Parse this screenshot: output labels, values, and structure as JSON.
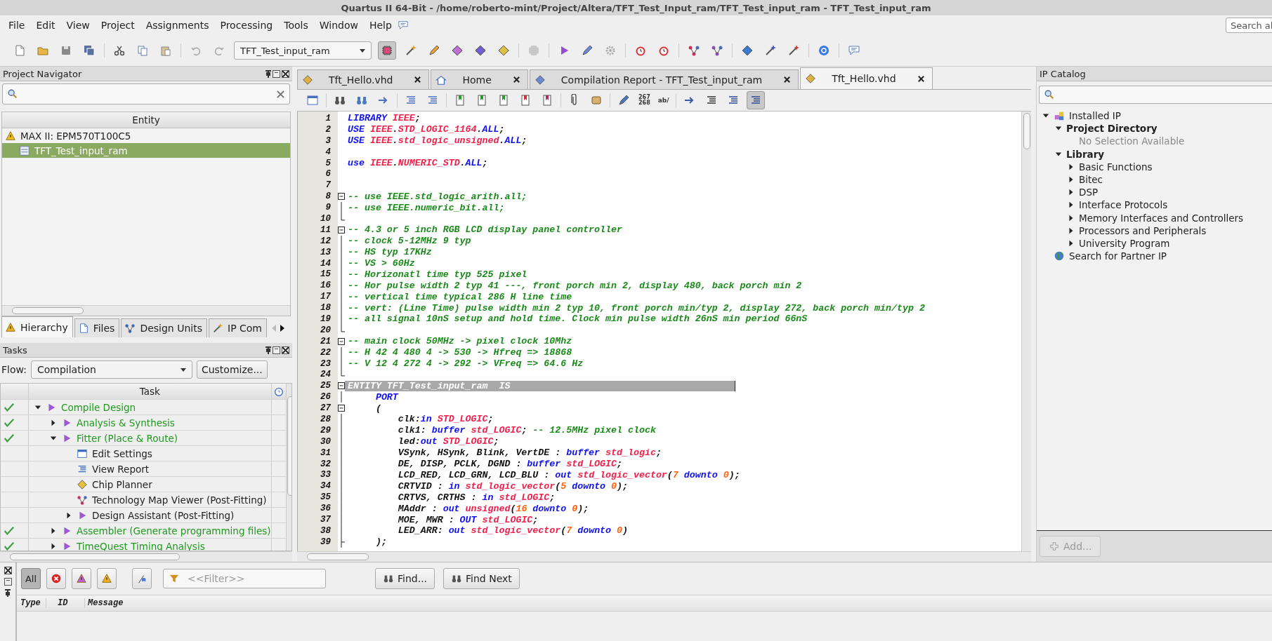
{
  "window": {
    "title": "Quartus II 64-Bit - /home/roberto-mint/Project/Altera/TFT_Test_Input_ram/TFT_Test_input_ram - TFT_Test_input_ram"
  },
  "menu": [
    "File",
    "Edit",
    "View",
    "Project",
    "Assignments",
    "Processing",
    "Tools",
    "Window",
    "Help"
  ],
  "search": {
    "placeholder": "Search al"
  },
  "toolbar": {
    "revision": "TFT_Test_input_ram"
  },
  "project_navigator": {
    "title": "Project Navigator",
    "column": "Entity",
    "rows": [
      {
        "label": "MAX II: EPM570T100C5",
        "kind": "device",
        "selected": false,
        "children": [
          {
            "label": "TFT_Test_input_ram",
            "kind": "entity",
            "selected": true
          }
        ]
      }
    ],
    "tabs": [
      {
        "label": "Hierarchy",
        "kind": "hierarchy",
        "selected": true
      },
      {
        "label": "Files",
        "kind": "files",
        "selected": false
      },
      {
        "label": "Design Units",
        "kind": "units",
        "selected": false
      },
      {
        "label": "IP Com",
        "kind": "ip",
        "selected": false
      }
    ]
  },
  "tasks": {
    "title": "Tasks",
    "flow_label": "Flow:",
    "flow": "Compilation",
    "customize": "Customize...",
    "column": "Task",
    "items": [
      {
        "label": "Compile Design",
        "kind": "flow",
        "done": true,
        "expanded": true,
        "children": [
          {
            "label": "Analysis & Synthesis",
            "kind": "flow",
            "done": true,
            "expanded": false
          },
          {
            "label": "Fitter (Place & Route)",
            "kind": "flow",
            "done": true,
            "expanded": true,
            "children": [
              {
                "label": "Edit Settings",
                "kind": "settings",
                "done": false
              },
              {
                "label": "View Report",
                "kind": "report",
                "done": false
              },
              {
                "label": "Chip Planner",
                "kind": "planner",
                "done": false
              },
              {
                "label": "Technology Map Viewer (Post-Fitting)",
                "kind": "viewer",
                "done": false
              },
              {
                "label": "Design Assistant (Post-Fitting)",
                "kind": "flow",
                "done": false,
                "expanded": false
              }
            ]
          },
          {
            "label": "Assembler (Generate programming files)",
            "kind": "flow",
            "done": true,
            "expanded": false
          },
          {
            "label": "TimeQuest Timing Analysis",
            "kind": "flow",
            "done": true,
            "expanded": false
          }
        ]
      }
    ]
  },
  "editor": {
    "tabs": [
      {
        "label": "Tft_Hello.vhd",
        "kind": "file",
        "selected": false
      },
      {
        "label": "Home",
        "kind": "home",
        "selected": false
      },
      {
        "label": "Compilation Report - TFT_Test_input_ram",
        "kind": "report",
        "selected": false
      },
      {
        "label": "Tft_Hello.vhd",
        "kind": "file",
        "selected": true
      }
    ],
    "toolbar_labels": {
      "goto_line": [
        "267",
        "268"
      ],
      "comment": "ab/"
    },
    "lines": [
      {
        "n": "1",
        "kind": "plain",
        "tokens": [
          {
            "kind": "keyword",
            "text": "LIBRARY"
          },
          {
            "kind": "type",
            "text": " IEEE"
          },
          {
            "kind": "plain",
            "text": ";"
          }
        ]
      },
      {
        "n": "2",
        "kind": "plain",
        "tokens": [
          {
            "kind": "keyword",
            "text": "USE"
          },
          {
            "kind": "type",
            "text": " IEEE"
          },
          {
            "kind": "plain",
            "text": "."
          },
          {
            "kind": "type",
            "text": "STD_LOGIC_1164"
          },
          {
            "kind": "plain",
            "text": "."
          },
          {
            "kind": "keyword",
            "text": "ALL"
          },
          {
            "kind": "plain",
            "text": ";"
          }
        ]
      },
      {
        "n": "3",
        "kind": "plain",
        "tokens": [
          {
            "kind": "keyword",
            "text": "USE"
          },
          {
            "kind": "type",
            "text": " IEEE"
          },
          {
            "kind": "plain",
            "text": "."
          },
          {
            "kind": "type",
            "text": "std_logic_unsigned"
          },
          {
            "kind": "plain",
            "text": "."
          },
          {
            "kind": "keyword",
            "text": "ALL"
          },
          {
            "kind": "plain",
            "text": ";"
          }
        ]
      },
      {
        "n": "4",
        "kind": "plain"
      },
      {
        "n": "5",
        "kind": "plain",
        "tokens": [
          {
            "kind": "keyword",
            "text": "use"
          },
          {
            "kind": "type",
            "text": " IEEE"
          },
          {
            "kind": "plain",
            "text": "."
          },
          {
            "kind": "type",
            "text": "NUMERIC_STD"
          },
          {
            "kind": "plain",
            "text": "."
          },
          {
            "kind": "keyword",
            "text": "ALL"
          },
          {
            "kind": "plain",
            "text": ";"
          }
        ]
      },
      {
        "n": "6",
        "kind": "plain"
      },
      {
        "n": "7",
        "kind": "plain"
      },
      {
        "n": "8",
        "kind": "fold_start",
        "tokens": [
          {
            "kind": "comment",
            "text": "-- use IEEE.std_logic_arith.all;"
          }
        ]
      },
      {
        "n": "9",
        "kind": "fold_body",
        "tokens": [
          {
            "kind": "comment",
            "text": "-- use IEEE.numeric_bit.all;"
          }
        ]
      },
      {
        "n": "10",
        "kind": "fold_end"
      },
      {
        "n": "11",
        "kind": "fold_start",
        "tokens": [
          {
            "kind": "comment",
            "text": "-- 4.3 or 5 inch RGB LCD display panel controller"
          }
        ]
      },
      {
        "n": "12",
        "kind": "fold_body",
        "tokens": [
          {
            "kind": "comment",
            "text": "-- clock 5-12MHz 9 typ"
          }
        ]
      },
      {
        "n": "13",
        "kind": "fold_body",
        "tokens": [
          {
            "kind": "comment",
            "text": "-- HS typ 17KHz"
          }
        ]
      },
      {
        "n": "14",
        "kind": "fold_body",
        "tokens": [
          {
            "kind": "comment",
            "text": "-- VS > 60Hz"
          }
        ]
      },
      {
        "n": "15",
        "kind": "fold_body",
        "tokens": [
          {
            "kind": "comment",
            "text": "-- Horizonatl time typ 525 pixel"
          }
        ]
      },
      {
        "n": "16",
        "kind": "fold_body",
        "tokens": [
          {
            "kind": "comment",
            "text": "-- Hor pulse width 2 typ 41 ---, front porch min 2, display 480, back porch min 2"
          }
        ]
      },
      {
        "n": "17",
        "kind": "fold_body",
        "tokens": [
          {
            "kind": "comment",
            "text": "-- vertical time typical 286 H line time"
          }
        ]
      },
      {
        "n": "18",
        "kind": "fold_body",
        "tokens": [
          {
            "kind": "comment",
            "text": "-- vert: (Line Time) pulse width min 2 typ 10, front porch min/typ 2, display 272, back porch min/typ 2"
          }
        ]
      },
      {
        "n": "19",
        "kind": "fold_body",
        "tokens": [
          {
            "kind": "comment",
            "text": "-- all signal 10nS setup and hold time. Clock min pulse width 26nS min period 66nS"
          }
        ]
      },
      {
        "n": "20",
        "kind": "fold_end"
      },
      {
        "n": "21",
        "kind": "fold_start",
        "tokens": [
          {
            "kind": "comment",
            "text": "-- main clock 50MHz -> pixel clock 10Mhz"
          }
        ]
      },
      {
        "n": "22",
        "kind": "fold_body",
        "tokens": [
          {
            "kind": "comment",
            "text": "-- H 42 4 480 4 -> 530 -> Hfreq => 18868"
          }
        ]
      },
      {
        "n": "23",
        "kind": "fold_body",
        "tokens": [
          {
            "kind": "comment",
            "text": "-- V 12 4 272 4 -> 292 -> VFreq => 64.6 Hz"
          }
        ]
      },
      {
        "n": "24",
        "kind": "fold_end"
      },
      {
        "n": "25",
        "kind": "fold_start",
        "highlighted": true,
        "tokens": [
          {
            "kind": "plain",
            "text": "ENTITY TFT_Test_input_ram  IS"
          }
        ]
      },
      {
        "n": "26",
        "kind": "fold_body",
        "tokens": [
          {
            "kind": "keyword",
            "text": "     PORT"
          }
        ]
      },
      {
        "n": "27",
        "kind": "fold_start",
        "tokens": [
          {
            "kind": "plain",
            "text": "     ("
          }
        ]
      },
      {
        "n": "28",
        "kind": "fold_body",
        "tokens": [
          {
            "kind": "plain",
            "text": "         clk:"
          },
          {
            "kind": "keyword",
            "text": "in"
          },
          {
            "kind": "type",
            "text": " STD_LOGIC"
          },
          {
            "kind": "plain",
            "text": ";"
          }
        ]
      },
      {
        "n": "29",
        "kind": "fold_body",
        "tokens": [
          {
            "kind": "plain",
            "text": "         clk1: "
          },
          {
            "kind": "keyword",
            "text": "buffer"
          },
          {
            "kind": "type",
            "text": " std_LOGIC"
          },
          {
            "kind": "plain",
            "text": ";"
          },
          {
            "kind": "comment",
            "text": " -- 12.5MHz pixel clock"
          }
        ]
      },
      {
        "n": "30",
        "kind": "fold_body",
        "tokens": [
          {
            "kind": "plain",
            "text": "         led:"
          },
          {
            "kind": "keyword",
            "text": "out"
          },
          {
            "kind": "type",
            "text": " STD_LOGIC"
          },
          {
            "kind": "plain",
            "text": ";"
          }
        ]
      },
      {
        "n": "31",
        "kind": "fold_body",
        "tokens": [
          {
            "kind": "plain",
            "text": "         VSynk, HSynk, Blink, VertDE : "
          },
          {
            "kind": "keyword",
            "text": "buffer"
          },
          {
            "kind": "type",
            "text": " std_logic"
          },
          {
            "kind": "plain",
            "text": ";"
          }
        ]
      },
      {
        "n": "32",
        "kind": "fold_body",
        "tokens": [
          {
            "kind": "plain",
            "text": "         DE, DISP, PCLK, DGND : "
          },
          {
            "kind": "keyword",
            "text": "buffer"
          },
          {
            "kind": "type",
            "text": " std_LOGIC"
          },
          {
            "kind": "plain",
            "text": ";"
          }
        ]
      },
      {
        "n": "33",
        "kind": "fold_body",
        "tokens": [
          {
            "kind": "plain",
            "text": "         LCD_RED, LCD_GRN, LCD_BLU : "
          },
          {
            "kind": "keyword",
            "text": "out"
          },
          {
            "kind": "type",
            "text": " std_logic_vector"
          },
          {
            "kind": "plain",
            "text": "("
          },
          {
            "kind": "number",
            "text": "7"
          },
          {
            "kind": "keyword",
            "text": " downto"
          },
          {
            "kind": "number",
            "text": " 0"
          },
          {
            "kind": "plain",
            "text": ");"
          }
        ]
      },
      {
        "n": "34",
        "kind": "fold_body",
        "tokens": [
          {
            "kind": "plain",
            "text": "         CRTVID : "
          },
          {
            "kind": "keyword",
            "text": "in"
          },
          {
            "kind": "type",
            "text": " std_logic_vector"
          },
          {
            "kind": "plain",
            "text": "("
          },
          {
            "kind": "number",
            "text": "5"
          },
          {
            "kind": "keyword",
            "text": " downto"
          },
          {
            "kind": "number",
            "text": " 0"
          },
          {
            "kind": "plain",
            "text": ");"
          }
        ]
      },
      {
        "n": "35",
        "kind": "fold_body",
        "tokens": [
          {
            "kind": "plain",
            "text": "         CRTVS, CRTHS : "
          },
          {
            "kind": "keyword",
            "text": "in"
          },
          {
            "kind": "type",
            "text": " std_LOGIC"
          },
          {
            "kind": "plain",
            "text": ";"
          }
        ]
      },
      {
        "n": "36",
        "kind": "fold_body",
        "tokens": [
          {
            "kind": "plain",
            "text": "         MAddr : "
          },
          {
            "kind": "keyword",
            "text": "out"
          },
          {
            "kind": "type",
            "text": " unsigned"
          },
          {
            "kind": "plain",
            "text": "("
          },
          {
            "kind": "number",
            "text": "16"
          },
          {
            "kind": "keyword",
            "text": " downto"
          },
          {
            "kind": "number",
            "text": " 0"
          },
          {
            "kind": "plain",
            "text": ");"
          }
        ]
      },
      {
        "n": "37",
        "kind": "fold_body",
        "tokens": [
          {
            "kind": "plain",
            "text": "         MOE, MWR : "
          },
          {
            "kind": "keyword",
            "text": "OUT"
          },
          {
            "kind": "type",
            "text": " std_LOGIC"
          },
          {
            "kind": "plain",
            "text": ";"
          }
        ]
      },
      {
        "n": "38",
        "kind": "fold_body",
        "tokens": [
          {
            "kind": "plain",
            "text": "         LED_ARR: "
          },
          {
            "kind": "keyword",
            "text": "out"
          },
          {
            "kind": "type",
            "text": " std_logic_vector"
          },
          {
            "kind": "plain",
            "text": "("
          },
          {
            "kind": "number",
            "text": "7"
          },
          {
            "kind": "keyword",
            "text": " downto"
          },
          {
            "kind": "number",
            "text": " 0"
          },
          {
            "kind": "plain",
            "text": ")"
          }
        ]
      },
      {
        "n": "39",
        "kind": "fold_branch",
        "tokens": [
          {
            "kind": "plain",
            "text": "     );"
          }
        ]
      }
    ]
  },
  "ip_catalog": {
    "title": "IP Catalog",
    "tree": [
      {
        "label": "Installed IP",
        "kind": "installed",
        "expanded": true,
        "children": [
          {
            "label": "Project Directory",
            "kind": "group",
            "expanded": true,
            "children": [
              {
                "label": "No Selection Available",
                "kind": "empty"
              }
            ]
          },
          {
            "label": "Library",
            "kind": "group",
            "expanded": true,
            "children": [
              {
                "label": "Basic Functions",
                "kind": "category",
                "expanded": false
              },
              {
                "label": "Bitec",
                "kind": "category",
                "expanded": false
              },
              {
                "label": "DSP",
                "kind": "category",
                "expanded": false
              },
              {
                "label": "Interface Protocols",
                "kind": "category",
                "expanded": false
              },
              {
                "label": "Memory Interfaces and Controllers",
                "kind": "category",
                "expanded": false
              },
              {
                "label": "Processors and Peripherals",
                "kind": "category",
                "expanded": false
              },
              {
                "label": "University Program",
                "kind": "category",
                "expanded": false
              }
            ]
          }
        ]
      },
      {
        "label": "Search for Partner IP",
        "kind": "partner"
      }
    ],
    "add_button": {
      "label": "Add...",
      "disabled": true
    }
  },
  "messages": {
    "filters": [
      {
        "kind": "all",
        "label": "All",
        "selected": true
      },
      {
        "kind": "error",
        "selected": false
      },
      {
        "kind": "critical",
        "selected": false
      },
      {
        "kind": "warning",
        "selected": false
      },
      {
        "kind": "suppressed",
        "selected": false
      }
    ],
    "filter_placeholder": "<<Filter>>",
    "find": "Find...",
    "find_next": "Find Next",
    "columns": [
      "Type",
      "ID",
      "Message"
    ]
  }
}
